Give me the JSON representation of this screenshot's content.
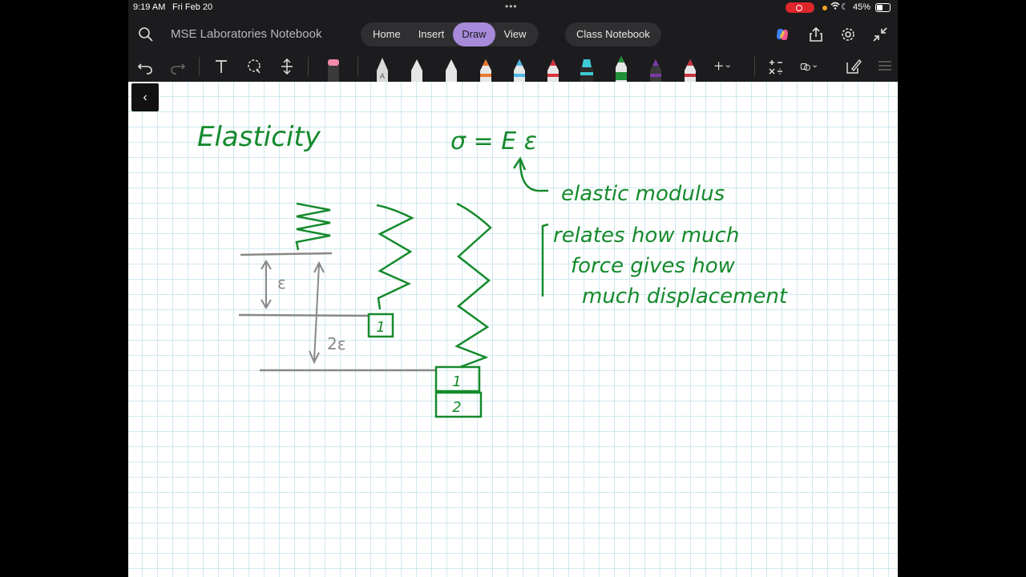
{
  "status_bar": {
    "time": "9:19 AM",
    "date": "Fri Feb 20",
    "battery": "45%"
  },
  "header": {
    "notebook_title": "MSE Laboratories Notebook",
    "tabs": [
      {
        "label": "Home",
        "active": false
      },
      {
        "label": "Insert",
        "active": false
      },
      {
        "label": "Draw",
        "active": true
      },
      {
        "label": "View",
        "active": false
      }
    ],
    "class_notebook_label": "Class Notebook"
  },
  "toolbar": {
    "tools": [
      "undo-icon",
      "redo-icon",
      "text-tool-icon",
      "lasso-select-icon",
      "insert-space-icon",
      "eraser-icon"
    ],
    "pens": [
      {
        "name": "pencil",
        "color": "#d9d9d9",
        "letter": "A"
      },
      {
        "name": "pen-white",
        "color": "#e6e6e6"
      },
      {
        "name": "pen-white-2",
        "color": "#e6e6e6"
      },
      {
        "name": "pen-orange",
        "color": "#e8772e"
      },
      {
        "name": "pen-blue",
        "color": "#4bb7e6"
      },
      {
        "name": "pen-red",
        "color": "#d8323c"
      },
      {
        "name": "highlighter-cyan",
        "color": "#3fc9d4"
      },
      {
        "name": "pen-green",
        "color": "#1f8f3a"
      },
      {
        "name": "pen-purple",
        "color": "#7b3aa8"
      },
      {
        "name": "pen-red-2",
        "color": "#c8323c"
      }
    ],
    "accent": "#a78bda"
  },
  "page": {
    "back_glyph": "‹",
    "notes": {
      "title": "Elasticity",
      "equation": "σ = E ε",
      "modulus_label": "elastic modulus",
      "explanation_line1": "relates how much",
      "explanation_line2": "force gives how",
      "explanation_line3": "much displacement",
      "strain_small": "ε",
      "strain_double": "2ε",
      "mass_1a": "1",
      "mass_1b": "1",
      "mass_2": "2"
    },
    "ink_color": "#158a2c",
    "guide_color": "#888888"
  }
}
